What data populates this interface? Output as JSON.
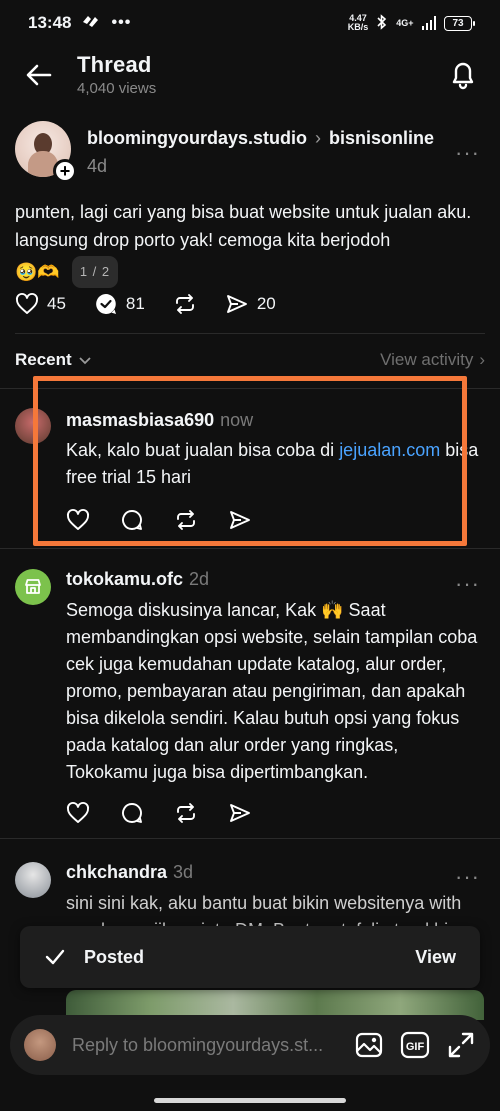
{
  "status": {
    "time": "13:48",
    "net_speed_value": "4.47",
    "net_speed_unit": "KB/s",
    "network": "4G+",
    "battery": "73"
  },
  "header": {
    "title": "Thread",
    "views": "4,040 views"
  },
  "op": {
    "author": "bloomingyourdays.studio",
    "community": "bisnisonline",
    "time": "4d",
    "text": "punten, lagi cari yang bisa buat website untuk jualan aku. langsung drop porto yak! cemoga kita berjodoh",
    "emojis": "🥹🫶",
    "pager": "1 / 2",
    "likes": "45",
    "replies": "81",
    "shares": "20"
  },
  "recent": {
    "label": "Recent",
    "view_activity": "View activity"
  },
  "replies": [
    {
      "author": "masmasbiasa690",
      "time": "now",
      "text_before": "Kak, kalo buat jualan bisa coba di ",
      "link": "jejualan.com",
      "text_after": " bisa free trial 15 hari"
    },
    {
      "author": "tokokamu.ofc",
      "time": "2d",
      "text": "Semoga diskusinya lancar, Kak 🙌 Saat membandingkan opsi website, selain tampilan coba cek juga kemudahan update katalog, alur order, promo, pembayaran atau pengiriman, dan apakah bisa dikelola sendiri. Kalau butuh opsi yang fokus pada katalog dan alur order yang ringkas, Tokokamu juga bisa dipertimbangkan."
    },
    {
      "author": "chkchandra",
      "time": "3d",
      "text": "sini sini kak, aku bantu buat bikin websitenya with wordpress jika minta DM. Buat portofolio terakhir bisa cek di jumpasadepan.id"
    }
  ],
  "toast": {
    "label": "Posted",
    "action": "View"
  },
  "reply_bar": {
    "placeholder": "Reply to bloomingyourdays.st..."
  },
  "colors": {
    "background": "#101010",
    "link": "#4aa3ff",
    "highlight": "#f5783a"
  }
}
